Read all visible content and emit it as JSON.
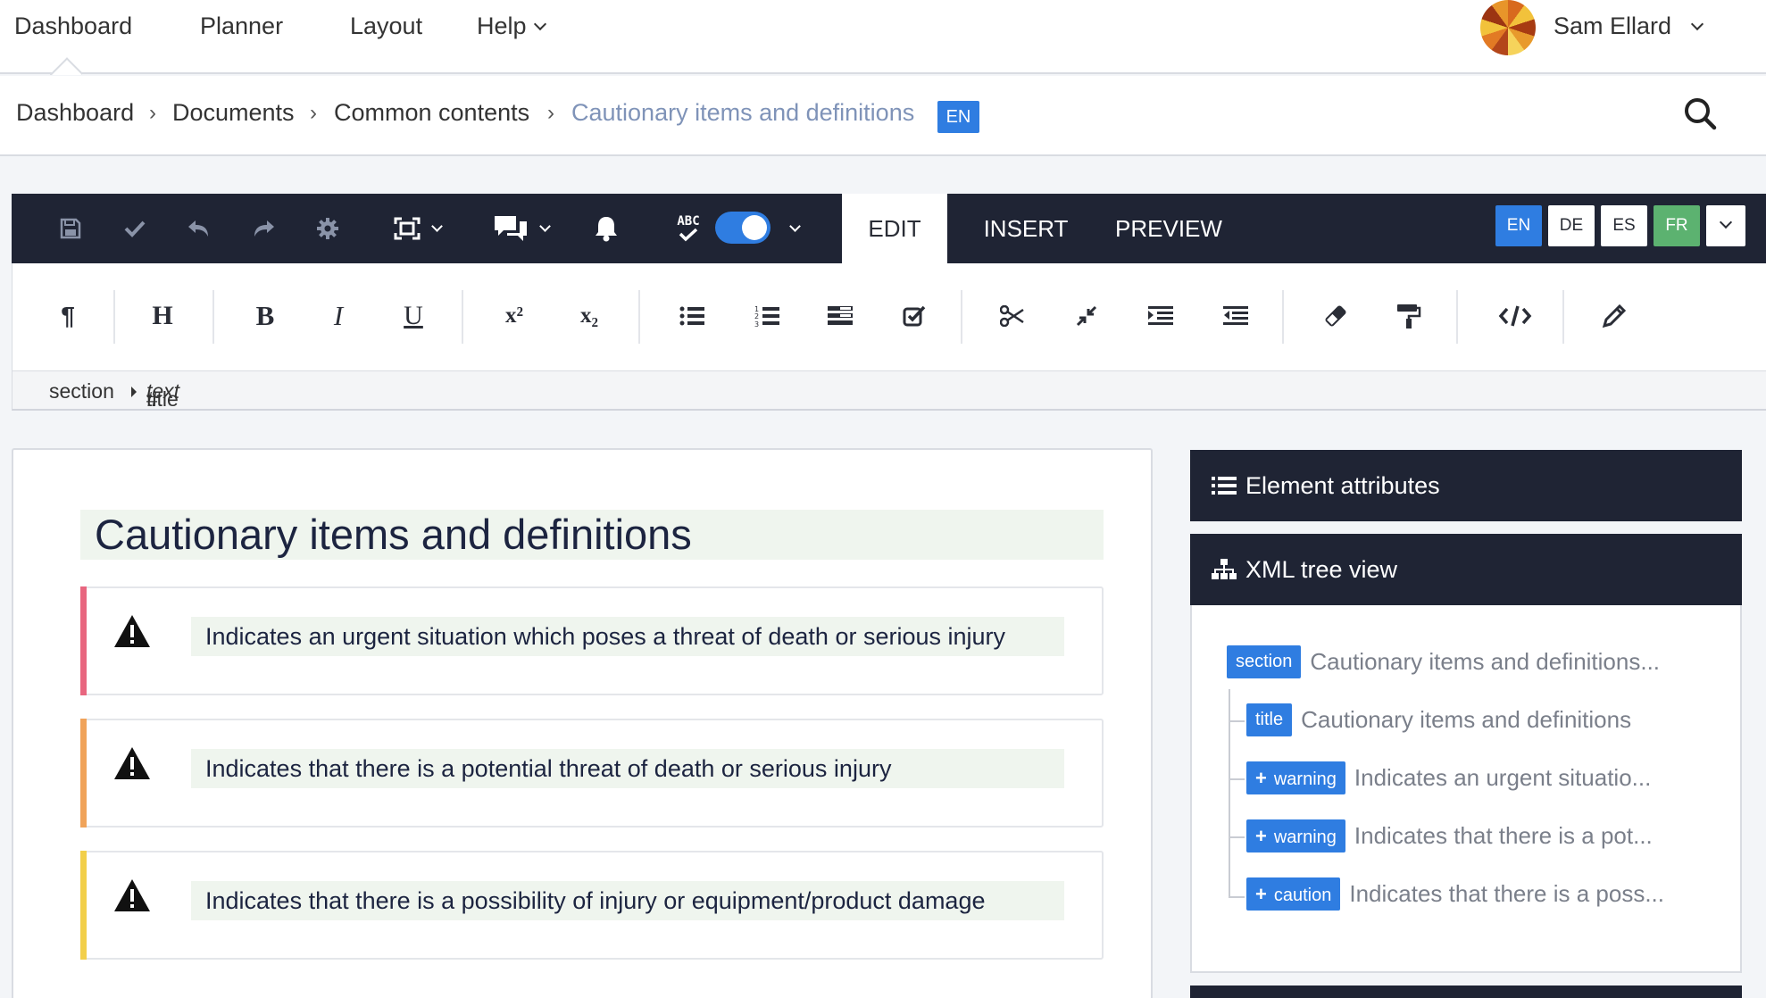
{
  "topnav": {
    "items": [
      "Dashboard",
      "Planner",
      "Layout",
      "Help"
    ],
    "user_name": "Sam Ellard"
  },
  "breadcrumb": {
    "items": [
      "Dashboard",
      "Documents",
      "Common contents"
    ],
    "separator": "›",
    "current": "Cautionary items and definitions",
    "lang": "EN"
  },
  "editor_toolbar": {
    "icons": [
      "save-icon",
      "check-icon",
      "undo-icon",
      "redo-icon",
      "gear-icon",
      "fullscreen-icon",
      "comments-icon",
      "bell-icon",
      "spellcheck-icon"
    ],
    "spellcheck_label": "ABC",
    "spellcheck_enabled": true,
    "modes": [
      "EDIT",
      "INSERT",
      "PREVIEW"
    ],
    "active_mode": "EDIT",
    "languages": [
      {
        "code": "EN",
        "bg": "#2f7de1",
        "fg": "#ffffff"
      },
      {
        "code": "DE",
        "bg": "#ffffff",
        "fg": "#2a2d36"
      },
      {
        "code": "ES",
        "bg": "#ffffff",
        "fg": "#2a2d36"
      },
      {
        "code": "FR",
        "bg": "#5cb270",
        "fg": "#ffffff"
      }
    ]
  },
  "format_toolbar": {
    "paragraph": "¶",
    "heading": "H",
    "bold": "B",
    "italic": "I",
    "underline": "U",
    "superscript": "x²",
    "subscript": "x₂"
  },
  "element_path": {
    "parent": "section",
    "child": "title",
    "child_suffix": "#",
    "child_type": "text"
  },
  "document": {
    "title": "Cautionary items and definitions",
    "notes": [
      {
        "type": "warning",
        "color": "#e8667f",
        "text": "Indicates an urgent situation which poses a threat of death or serious injury"
      },
      {
        "type": "warning",
        "color": "#f0a35a",
        "text": "Indicates that there is a potential threat of death or serious injury"
      },
      {
        "type": "caution",
        "color": "#f2cf4a",
        "text": "Indicates that there is a possibility of injury or equipment/product damage"
      }
    ]
  },
  "panels": {
    "attributes_title": "Element attributes",
    "xml_tree_title": "XML tree view",
    "tree": [
      {
        "tag": "section",
        "text": "Cautionary items and definitions...",
        "expandable": false
      },
      {
        "tag": "title",
        "text": "Cautionary items and definitions",
        "expandable": false
      },
      {
        "tag": "warning",
        "text": "Indicates an urgent situatio...",
        "expandable": true
      },
      {
        "tag": "warning",
        "text": "Indicates that there is a pot...",
        "expandable": true
      },
      {
        "tag": "caution",
        "text": "Indicates that there is a poss...",
        "expandable": true
      }
    ]
  },
  "colors": {
    "accent": "#2f7de1",
    "toolbar_dark": "#1f2434",
    "highlight_green": "#eff5ee"
  }
}
